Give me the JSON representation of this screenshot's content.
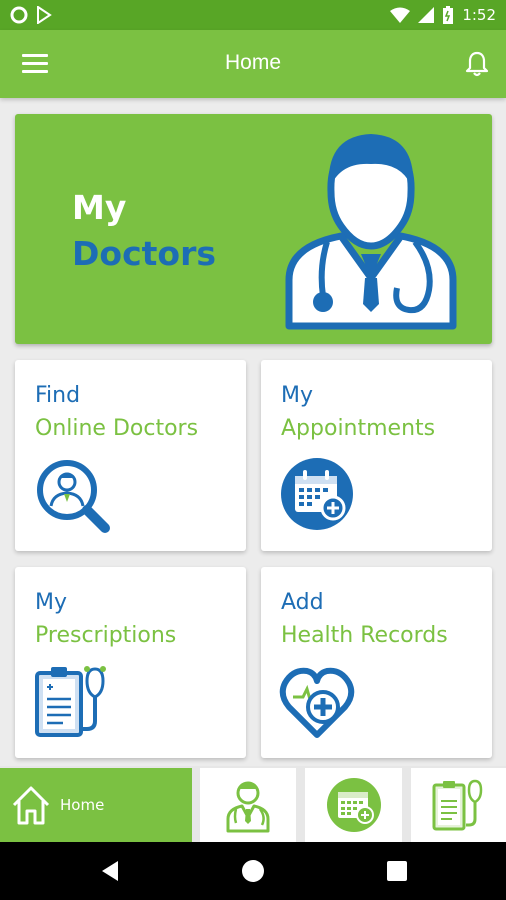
{
  "status_bar": {
    "time": "1:52"
  },
  "app_bar": {
    "title": "Home"
  },
  "hero": {
    "line1": "My",
    "line2": "Doctors"
  },
  "tiles": [
    {
      "line1": "Find",
      "line2": "Online Doctors",
      "icon": "doctor-search-icon"
    },
    {
      "line1": "My",
      "line2": "Appointments",
      "icon": "calendar-add-icon"
    },
    {
      "line1": "My",
      "line2": "Prescriptions",
      "icon": "clipboard-stethoscope-icon"
    },
    {
      "line1": "Add",
      "line2": "Health Records",
      "icon": "heart-plus-icon"
    }
  ],
  "bottom_nav": {
    "home_label": "Home",
    "items": [
      "home-icon",
      "doctor-icon",
      "calendar-icon",
      "prescription-icon"
    ]
  },
  "colors": {
    "green": "#7bc142",
    "status_green": "#58a626",
    "blue": "#1d6db5"
  }
}
